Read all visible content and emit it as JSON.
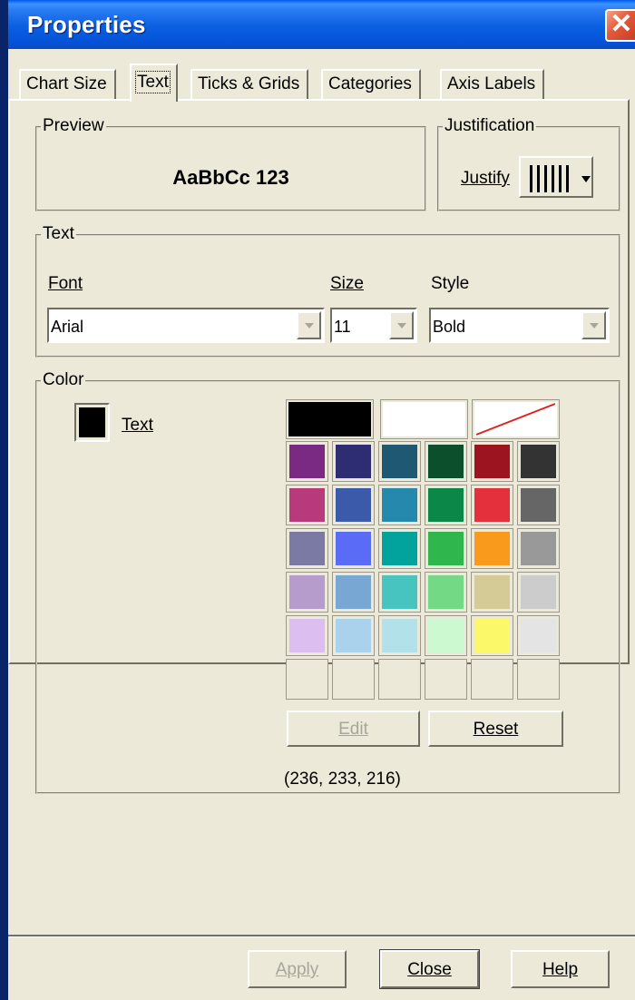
{
  "window": {
    "title": "Properties",
    "close_label": "✕"
  },
  "tabs": [
    {
      "label": "Chart Size"
    },
    {
      "label": "Text"
    },
    {
      "label": "Ticks & Grids"
    },
    {
      "label": "Categories"
    },
    {
      "label": "Axis Labels"
    }
  ],
  "preview": {
    "legend": "Preview",
    "sample": "AaBbCc 123"
  },
  "justification": {
    "legend": "Justification",
    "label": "Justify"
  },
  "text_group": {
    "legend": "Text",
    "font": {
      "label": "Font",
      "value": "Arial"
    },
    "size": {
      "label": "Size",
      "value": "11"
    },
    "style": {
      "label": "Style",
      "value": "Bold"
    }
  },
  "color_group": {
    "legend": "Color",
    "target_label": "Text",
    "current_color": "#000000",
    "big_swatches": [
      "#000000",
      "#ffffff",
      "none"
    ],
    "palette": [
      [
        "#7b2a83",
        "#2e2c73",
        "#1f5873",
        "#0b4f2c",
        "#9c1420",
        "#333333"
      ],
      [
        "#b83a7c",
        "#3b5aaa",
        "#2489ac",
        "#0b8847",
        "#e4303d",
        "#666666"
      ],
      [
        "#7b7aa4",
        "#5a6bf5",
        "#03a39d",
        "#2fb64d",
        "#f99a1c",
        "#999999"
      ],
      [
        "#b69bcd",
        "#79a7d4",
        "#47c3c0",
        "#73d985",
        "#d4cb96",
        "#cccccc"
      ],
      [
        "#dcbff0",
        "#aad2ec",
        "#b2e1ea",
        "#ccf9d0",
        "#fbf86a",
        "#e4e4e4"
      ],
      [
        "#ece9d8",
        "#ece9d8",
        "#ece9d8",
        "#ece9d8",
        "#ece9d8",
        "#ece9d8"
      ]
    ],
    "edit_label": "Edit",
    "reset_label": "Reset",
    "rgb_readout": "(236, 233, 216)"
  },
  "footer": {
    "apply_label": "Apply",
    "close_label": "Close",
    "help_label": "Help"
  }
}
